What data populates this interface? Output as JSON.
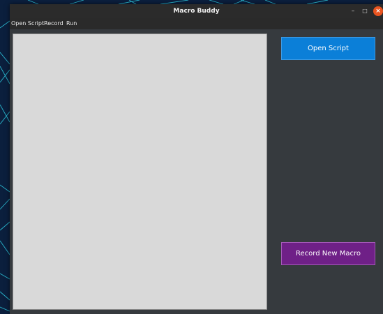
{
  "window": {
    "title": "Macro Buddy",
    "controls": {
      "minimize": "–",
      "maximize": "□",
      "close": "×"
    }
  },
  "menubar": {
    "items": [
      {
        "label": "Open Script"
      },
      {
        "label": "Record"
      },
      {
        "label": "Run"
      }
    ]
  },
  "editor": {
    "content": ""
  },
  "buttons": {
    "open_script": "Open Script",
    "record_new_macro": "Record New Macro"
  },
  "colors": {
    "window_bg": "#363a3e",
    "titlebar_bg": "#2b2b2b",
    "editor_bg": "#d9d9d9",
    "open_button": "#0b7fd8",
    "record_button": "#6f2087",
    "close_control": "#e95420"
  }
}
